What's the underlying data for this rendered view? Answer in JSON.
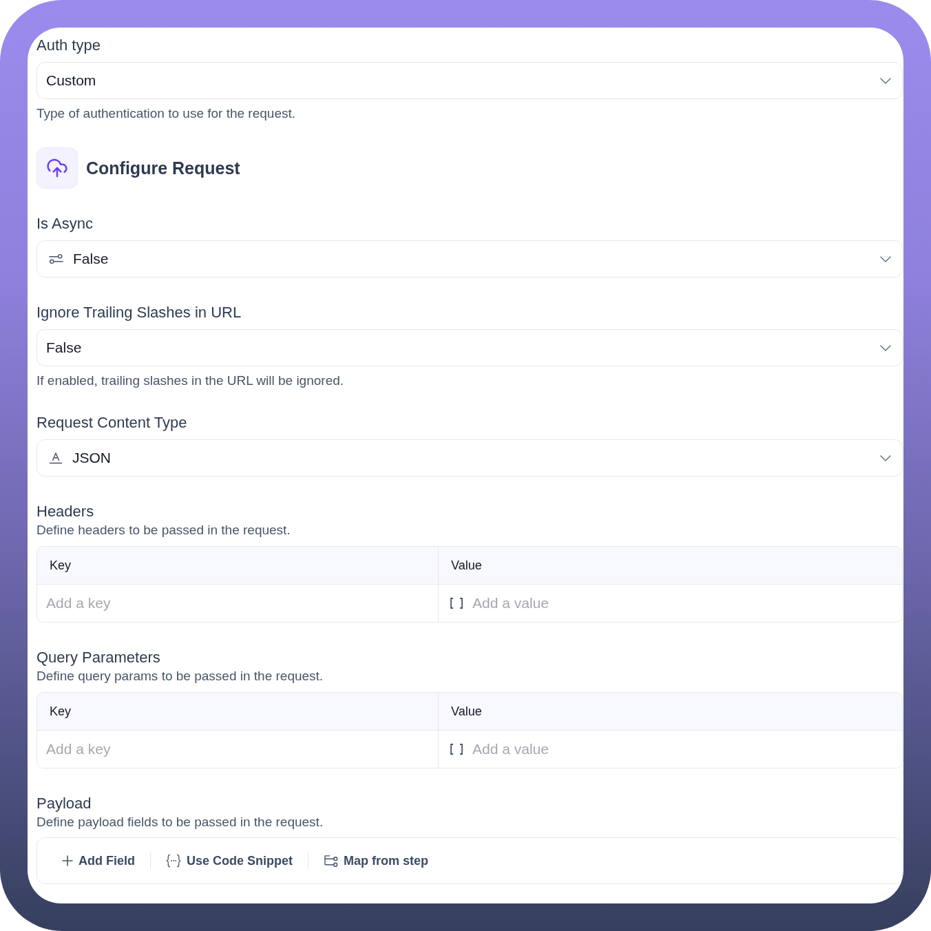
{
  "auth_type": {
    "label": "Auth type",
    "value": "Custom",
    "help": "Type of authentication to use for the request."
  },
  "section": {
    "title": "Configure Request"
  },
  "fields": [
    {
      "kind": "toggle",
      "label": "Is Async",
      "value": "False"
    },
    {
      "kind": "plain",
      "label": "Ignore Trailing Slashes in URL",
      "value": "False",
      "help": "If enabled, trailing slashes in the URL will be ignored."
    },
    {
      "kind": "format",
      "label": "Request Content Type",
      "value": "JSON"
    }
  ],
  "tables": [
    {
      "title": "Headers",
      "description": "Define headers to be passed in the request.",
      "columns": [
        "Key",
        "Value"
      ],
      "key_placeholder": "Add a key",
      "value_placeholder": "Add a value"
    },
    {
      "title": "Query Parameters",
      "description": "Define query params to be passed in the request.",
      "columns": [
        "Key",
        "Value"
      ],
      "key_placeholder": "Add a key",
      "value_placeholder": "Add a value"
    }
  ],
  "payload": {
    "title": "Payload",
    "description": "Define payload fields to be passed in the request.",
    "actions": [
      {
        "kind": "add",
        "label": "Add Field"
      },
      {
        "kind": "snippet",
        "label": "Use Code Snippet"
      },
      {
        "kind": "map",
        "label": "Map from step"
      }
    ]
  }
}
